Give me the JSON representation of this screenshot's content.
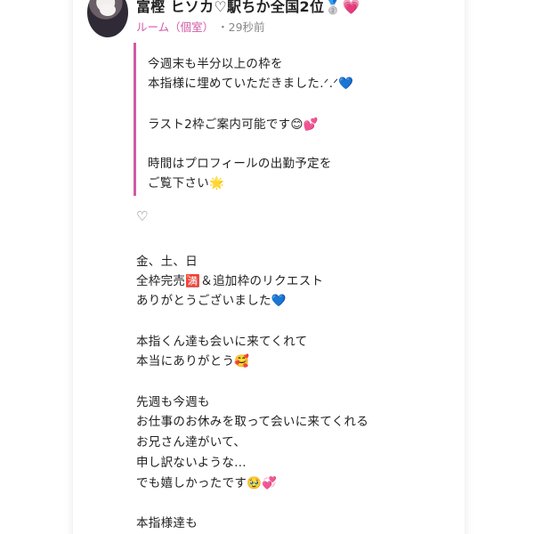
{
  "post": {
    "author_name": "富樫 ヒソカ♡駅ちか全国2位🥈💗",
    "category": "ルーム（個室）",
    "time_ago": "・29秒前"
  },
  "quote": {
    "lines": [
      "今週末も半分以上の枠を",
      "本指様に埋めていただきました.ᐟ.ᐟ💙",
      "",
      "ラスト2枠ご案内可能です😊💕",
      "",
      "時間はプロフィールの出勤予定を",
      "ご覧下さい🌟"
    ]
  },
  "body": {
    "heart": "♡",
    "lines": [
      "金、土、日",
      "全枠完売🈵＆追加枠のリクエスト",
      "ありがとうございました💙",
      "",
      "本指くん達も会いに来てくれて",
      "本当にありがとう🥰",
      "",
      "先週も今週も",
      "お仕事のお休みを取って会いに来てくれる",
      "お兄さん達がいて、",
      "申し訳ないような…",
      "でも嬉しかったです🥹💞",
      "",
      "本指様達も"
    ]
  },
  "colors": {
    "accent": "#d25aa7",
    "muted": "#888888",
    "text": "#222222",
    "background": "#ffffff"
  }
}
